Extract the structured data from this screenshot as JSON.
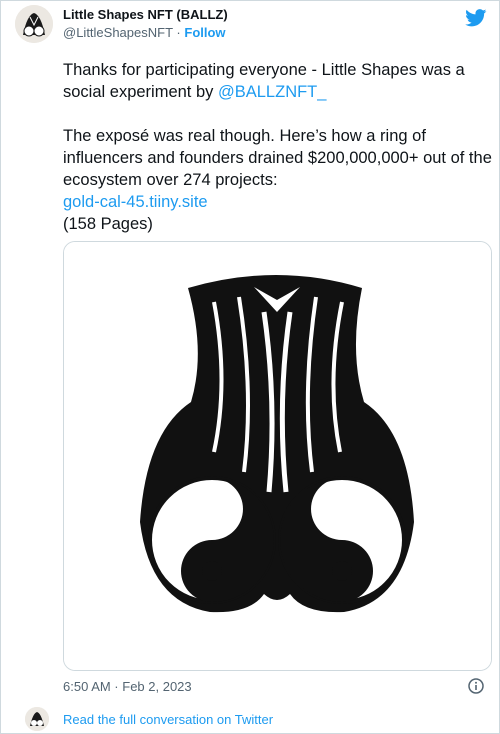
{
  "author": {
    "display_name": "Little Shapes NFT (BALLZ)",
    "handle": "@LittleShapesNFT",
    "separator": "·",
    "follow_label": "Follow"
  },
  "tweet": {
    "line1_text": "Thanks for participating everyone - Little Shapes was a social experiment by ",
    "mention": "@BALLZNFT_",
    "paragraph2": "The exposé was real though. Here’s how a ring of influencers and founders drained $200,000,000+ out of the ecosystem over 274 projects:",
    "link": "gold-cal-45.tiiny.site",
    "pages": "(158 Pages)"
  },
  "meta": {
    "timestamp": "6:50 AM · Feb 2, 2023"
  },
  "footer": {
    "read_more": "Read the full conversation on Twitter"
  },
  "colors": {
    "accent": "#1d9bf0",
    "text": "#0f1419",
    "muted": "#536471",
    "border": "#cfd9de"
  },
  "icons": {
    "brand": "twitter-bird-icon",
    "info": "info-icon"
  }
}
